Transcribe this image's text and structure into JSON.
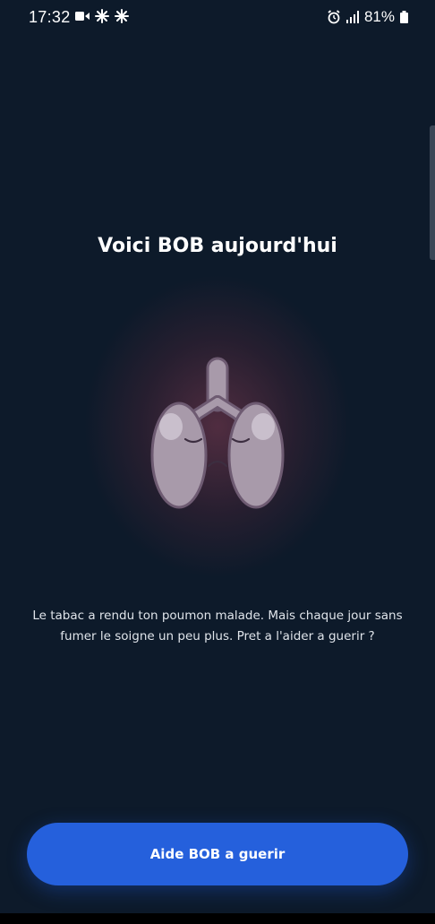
{
  "status_bar": {
    "time": "17:32",
    "battery": "81%",
    "icons": [
      "video-camera-icon",
      "sparkle-icon",
      "sparkle-icon",
      "alarm-icon",
      "signal-icon",
      "battery-icon"
    ]
  },
  "screen": {
    "title": "Voici BOB aujourd'hui",
    "description": "Le tabac a rendu ton poumon malade. Mais chaque jour sans fumer le soigne un peu plus. Pret a l'aider a guerir ?",
    "cta_label": "Aide BOB a guerir"
  },
  "colors": {
    "background": "#0d1a2a",
    "accent": "#2560dc",
    "lung_fill": "#a89aaa",
    "lung_outline": "#6e5b72"
  }
}
